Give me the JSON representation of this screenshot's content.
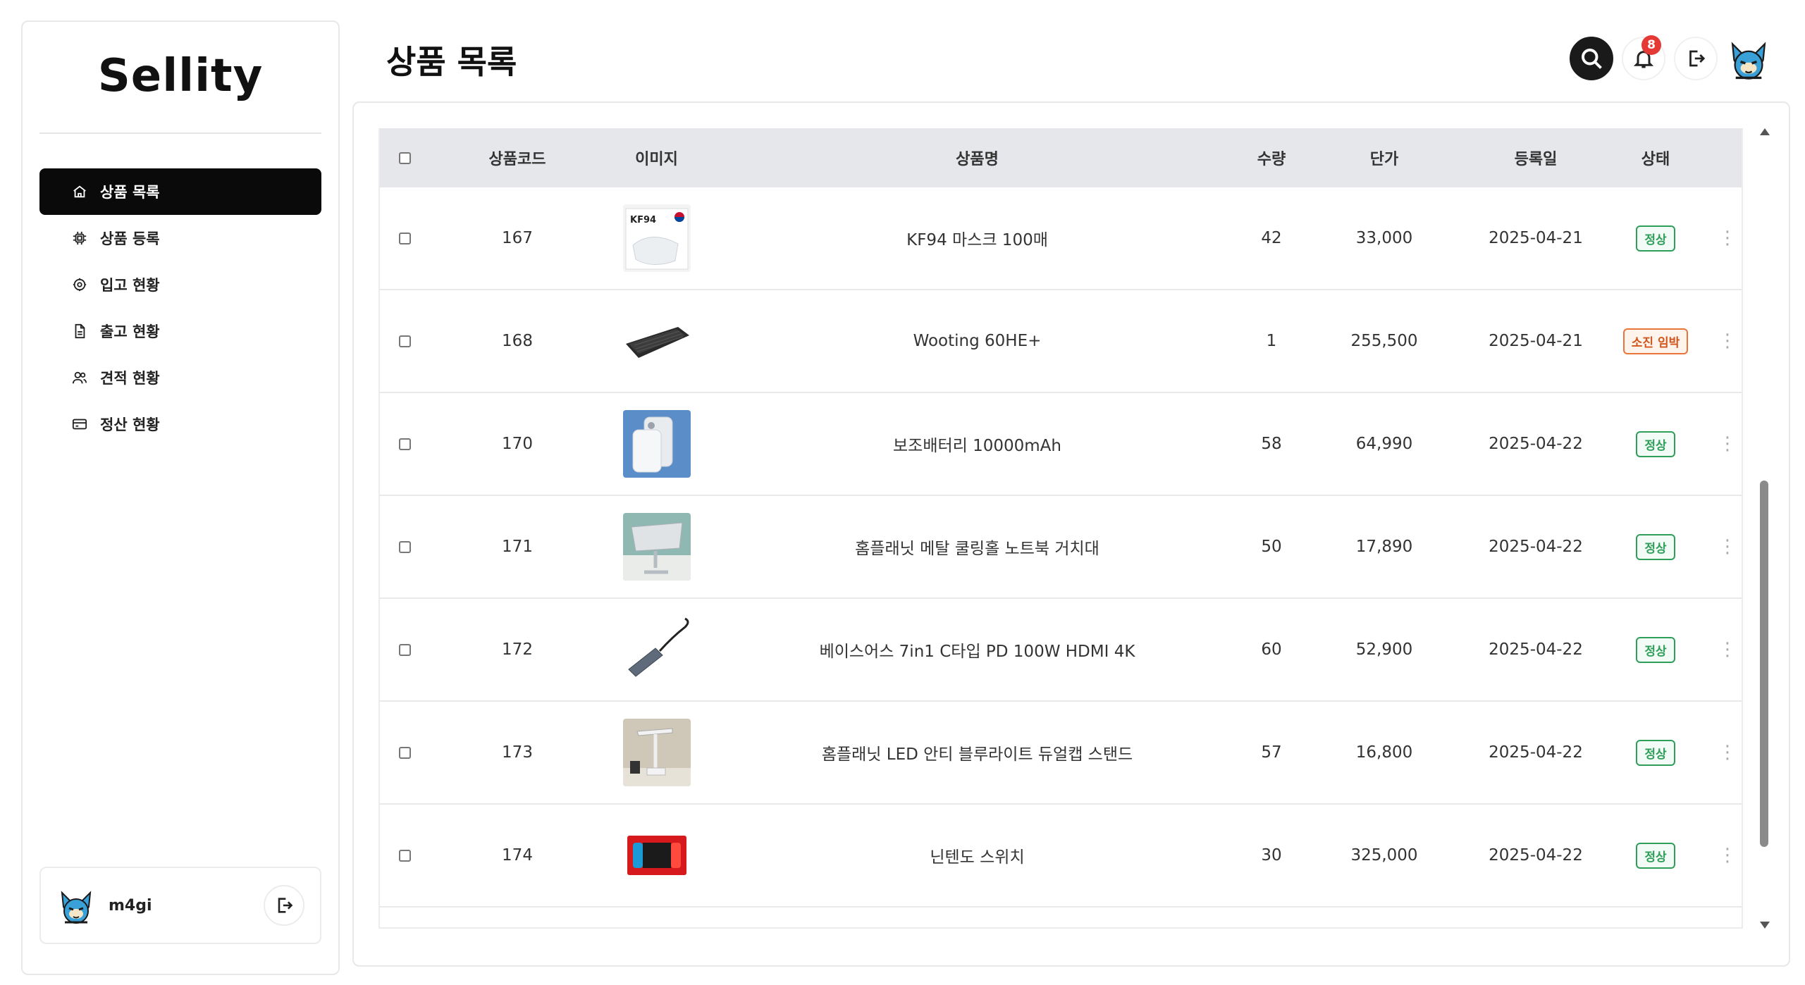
{
  "brand": {
    "logo_text": "Sellity"
  },
  "sidebar": {
    "items": [
      {
        "label": "상품 목록",
        "icon": "home-icon",
        "active": true
      },
      {
        "label": "상품 등록",
        "icon": "chip-icon",
        "active": false
      },
      {
        "label": "입고 현황",
        "icon": "gear-icon",
        "active": false
      },
      {
        "label": "출고 현황",
        "icon": "document-icon",
        "active": false
      },
      {
        "label": "견적 현황",
        "icon": "users-icon",
        "active": false
      },
      {
        "label": "정산 현황",
        "icon": "credit-card-icon",
        "active": false
      }
    ],
    "user": {
      "name": "m4gi",
      "avatar_icon": "cat-avatar-icon",
      "logout_icon": "logout-icon"
    }
  },
  "header": {
    "title": "상품 목록",
    "notification_count": "8",
    "icons": [
      "search-icon",
      "bell-icon",
      "logout-icon",
      "cat-avatar-icon"
    ]
  },
  "table": {
    "columns": [
      "상품코드",
      "이미지",
      "상품명",
      "수량",
      "단가",
      "등록일",
      "상태"
    ],
    "rows": [
      {
        "code": "167",
        "image": "kf94-mask",
        "name": "KF94 마스크 100매",
        "qty": "42",
        "price": "33,000",
        "date": "2025-04-21",
        "status": "정상",
        "status_type": "ok"
      },
      {
        "code": "168",
        "image": "keyboard",
        "name": "Wooting 60HE+",
        "qty": "1",
        "price": "255,500",
        "date": "2025-04-21",
        "status": "소진 임박",
        "status_type": "warn"
      },
      {
        "code": "170",
        "image": "power-bank",
        "name": "보조배터리 10000mAh",
        "qty": "58",
        "price": "64,990",
        "date": "2025-04-22",
        "status": "정상",
        "status_type": "ok"
      },
      {
        "code": "171",
        "image": "laptop-stand",
        "name": "홈플래닛 메탈 쿨링홀 노트북 거치대",
        "qty": "50",
        "price": "17,890",
        "date": "2025-04-22",
        "status": "정상",
        "status_type": "ok"
      },
      {
        "code": "172",
        "image": "usb-hub",
        "name": "베이스어스 7in1 C타입 PD 100W HDMI 4K",
        "qty": "60",
        "price": "52,900",
        "date": "2025-04-22",
        "status": "정상",
        "status_type": "ok"
      },
      {
        "code": "173",
        "image": "desk-lamp",
        "name": "홈플래닛 LED 안티 블루라이트 듀얼캡 스탠드",
        "qty": "57",
        "price": "16,800",
        "date": "2025-04-22",
        "status": "정상",
        "status_type": "ok"
      },
      {
        "code": "174",
        "image": "nintendo-switch",
        "name": "닌텐도 스위치",
        "qty": "30",
        "price": "325,000",
        "date": "2025-04-22",
        "status": "정상",
        "status_type": "ok"
      }
    ]
  },
  "colors": {
    "active_nav": "#0a0a0a",
    "status_ok": "#2e9e59",
    "status_warn": "#d2551c",
    "badge": "#e53935",
    "table_header": "#e6e7eb"
  }
}
